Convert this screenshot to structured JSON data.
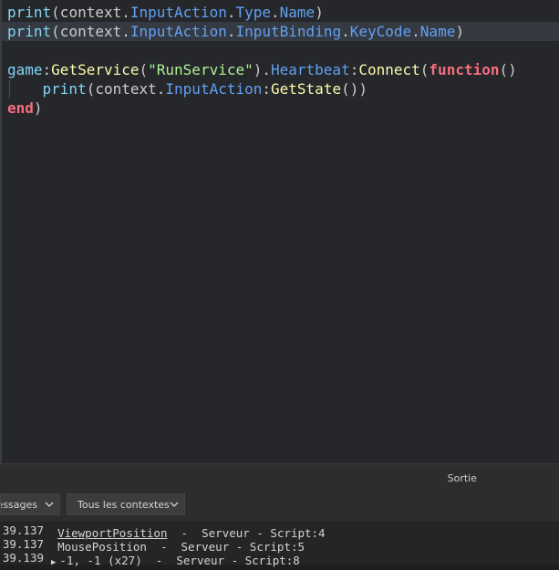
{
  "editor": {
    "lines": [
      {
        "tokens": [
          {
            "t": "print",
            "c": "t-builtin"
          },
          {
            "t": "(context.",
            "c": "t-punc"
          },
          {
            "t": "InputAction",
            "c": "t-prop"
          },
          {
            "t": ".",
            "c": "t-punc"
          },
          {
            "t": "Type",
            "c": "t-prop"
          },
          {
            "t": ".",
            "c": "t-punc"
          },
          {
            "t": "Name",
            "c": "t-prop"
          },
          {
            "t": ")",
            "c": "t-punc"
          }
        ]
      },
      {
        "current": true,
        "tokens": [
          {
            "t": "print",
            "c": "t-builtin"
          },
          {
            "t": "(context.",
            "c": "t-punc"
          },
          {
            "t": "InputAction",
            "c": "t-prop"
          },
          {
            "t": ".",
            "c": "t-punc"
          },
          {
            "t": "InputBinding",
            "c": "t-prop"
          },
          {
            "t": ".",
            "c": "t-punc"
          },
          {
            "t": "KeyCode",
            "c": "t-prop"
          },
          {
            "t": ".",
            "c": "t-punc"
          },
          {
            "t": "Name",
            "c": "t-prop"
          },
          {
            "t": ")",
            "c": "t-punc"
          }
        ]
      },
      {
        "tokens": []
      },
      {
        "tokens": [
          {
            "t": "game",
            "c": "t-builtin"
          },
          {
            "t": ":",
            "c": "t-punc"
          },
          {
            "t": "GetService",
            "c": "t-fn"
          },
          {
            "t": "(",
            "c": "t-punc"
          },
          {
            "t": "\"RunService\"",
            "c": "t-str"
          },
          {
            "t": ").",
            "c": "t-punc"
          },
          {
            "t": "Heartbeat",
            "c": "t-prop"
          },
          {
            "t": ":",
            "c": "t-punc"
          },
          {
            "t": "Connect",
            "c": "t-fn"
          },
          {
            "t": "(",
            "c": "t-punc"
          },
          {
            "t": "function",
            "c": "t-kw"
          },
          {
            "t": "()",
            "c": "t-punc"
          }
        ]
      },
      {
        "tokens": [
          {
            "t": "    ",
            "c": "t-punc"
          },
          {
            "t": "print",
            "c": "t-builtin"
          },
          {
            "t": "(context.",
            "c": "t-punc"
          },
          {
            "t": "InputAction",
            "c": "t-prop"
          },
          {
            "t": ":",
            "c": "t-punc"
          },
          {
            "t": "GetState",
            "c": "t-fn"
          },
          {
            "t": "())",
            "c": "t-punc"
          }
        ]
      },
      {
        "tokens": [
          {
            "t": "end",
            "c": "t-kw"
          },
          {
            "t": ")",
            "c": "t-punc"
          }
        ]
      }
    ]
  },
  "output_panel": {
    "title": "Sortie",
    "filters": {
      "messages_label": "essages",
      "contexts_label": "Tous les contextes"
    },
    "lines": [
      {
        "time": "39.137",
        "message": "ViewportPosition",
        "link": true,
        "expand": false,
        "source": "  -  Serveur - Script:4"
      },
      {
        "time": "39.137",
        "message": "MousePosition",
        "link": false,
        "expand": false,
        "source": "  -  Serveur - Script:5"
      },
      {
        "time": "39.139",
        "message": "-1, -1 (x27)",
        "link": false,
        "expand": true,
        "source": "  -  Serveur - Script:8"
      }
    ]
  }
}
